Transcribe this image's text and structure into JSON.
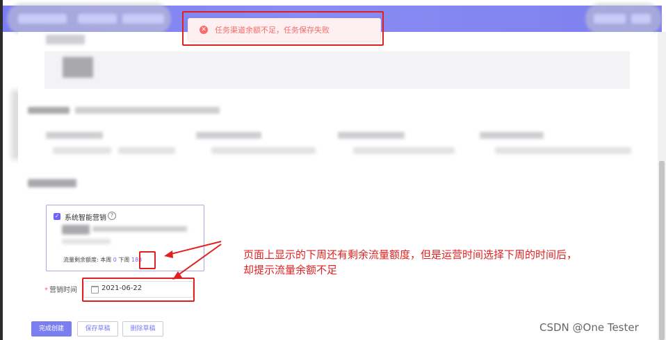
{
  "toast": {
    "icon": "error-circle-icon",
    "message": "任务渠道余额不足，任务保存失败",
    "color": "#f56c6c"
  },
  "marketing": {
    "checkbox_checked": true,
    "title": "系统智能营销",
    "help_icon": "question-circle-icon",
    "quota_label": "流量剩余额度:",
    "this_week_label": "本周",
    "this_week_value": "0",
    "next_week_label": "下周",
    "next_week_value": "183"
  },
  "schedule": {
    "required_mark": "*",
    "label": "营销时间",
    "calendar_icon": "calendar-icon",
    "date_value": "2021-06-22"
  },
  "actions": {
    "finish_label": "完成创建",
    "save_draft_label": "保存草稿",
    "delete_draft_label": "删除草稿"
  },
  "annotation": {
    "line1": "页面上显示的下周还有剩余流量额度，但是运营时间选择下周的时间后，",
    "line2": "却提示流量余额不足",
    "color": "#e02020"
  },
  "watermark": "CSDN @One Tester",
  "colors": {
    "nav": "#7b7ef0",
    "accent": "#6c63ff",
    "error": "#f56c6c",
    "highlight": "#e02020"
  }
}
